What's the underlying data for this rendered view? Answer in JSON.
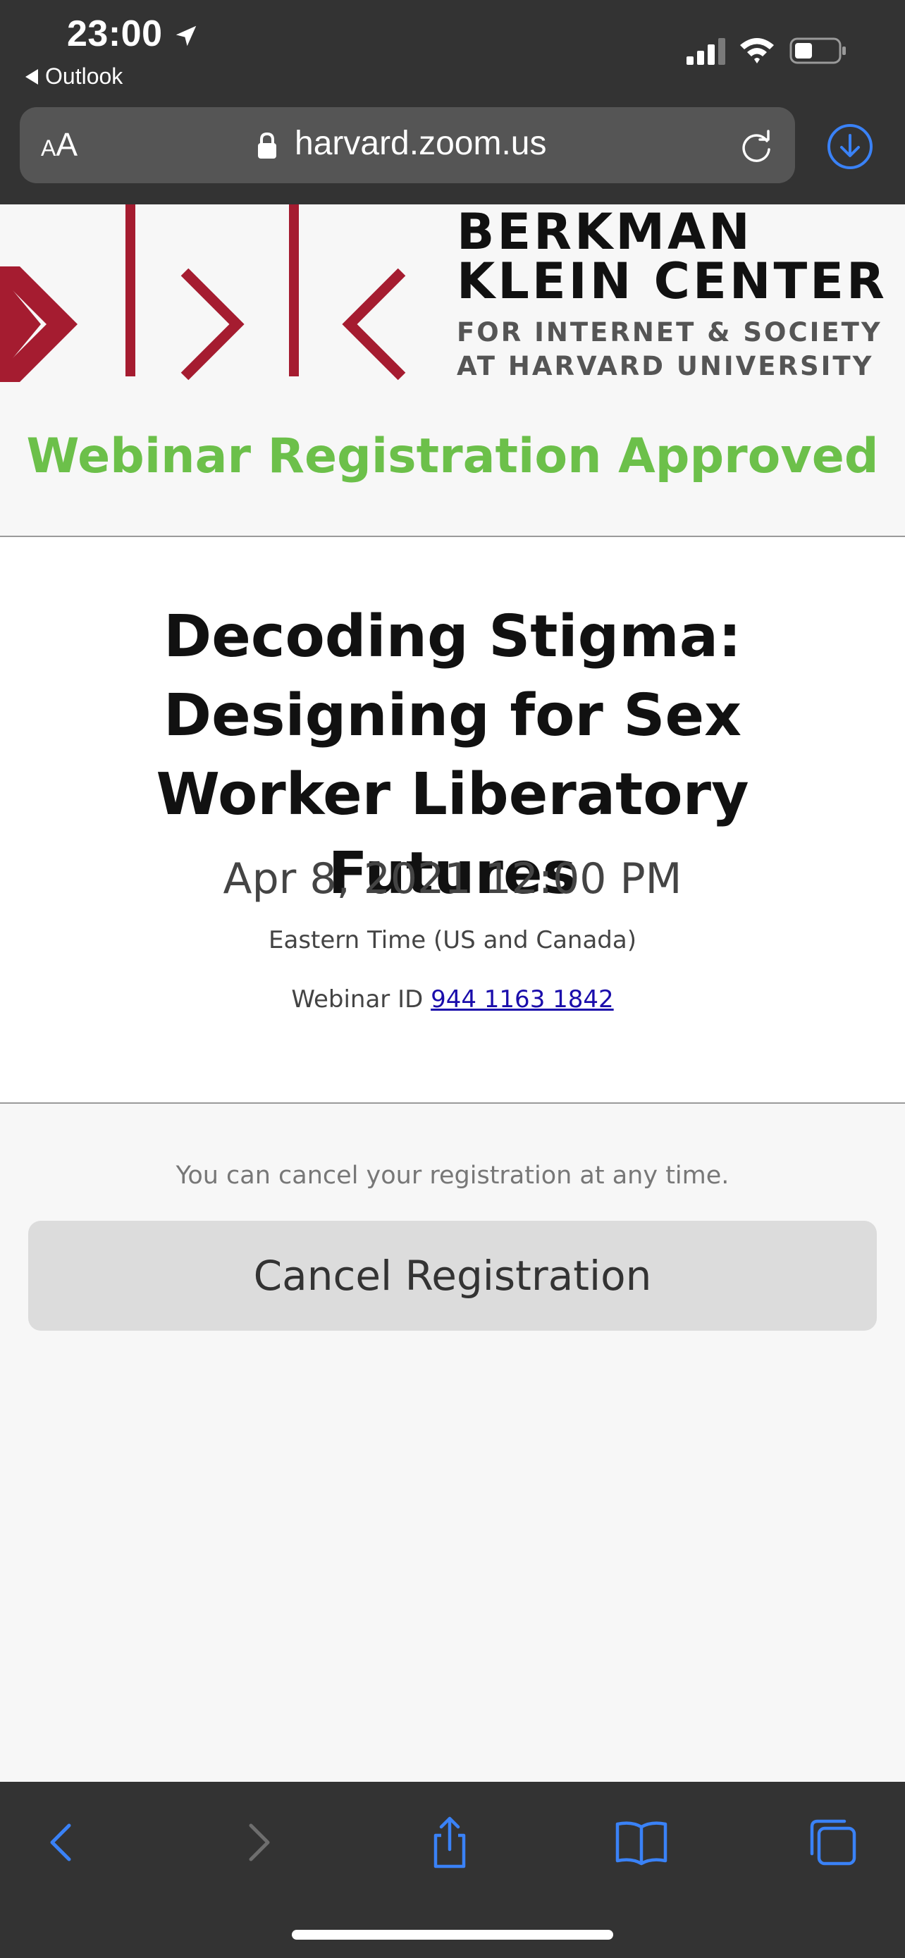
{
  "status_bar": {
    "time": "23:00",
    "back_app_label": "Outlook"
  },
  "browser": {
    "text_size_label_small": "A",
    "text_size_label_large": "A",
    "domain": "harvard.zoom.us",
    "accent_color": "#3a82f7"
  },
  "logo": {
    "line1": "BERKMAN",
    "line2": "KLEIN CENTER",
    "line3": "FOR INTERNET & SOCIETY",
    "line4": "AT HARVARD UNIVERSITY",
    "brand_color": "#a51c30"
  },
  "page": {
    "status_heading": "Webinar Registration Approved",
    "status_color": "#6cc04a"
  },
  "event": {
    "title": "Decoding Stigma: Designing for Sex Worker Liberatory Futures",
    "date_time": "Apr 8, 2021 12:00 PM",
    "timezone": "Eastern Time (US and Canada)",
    "webinar_id_label": "Webinar ID",
    "webinar_id": "944 1163 1842"
  },
  "cancel": {
    "note": "You can cancel your registration at any time.",
    "button_label": "Cancel Registration"
  },
  "toolbar": {
    "icons": [
      "back-icon",
      "forward-icon",
      "share-icon",
      "bookmarks-icon",
      "tabs-icon"
    ]
  }
}
